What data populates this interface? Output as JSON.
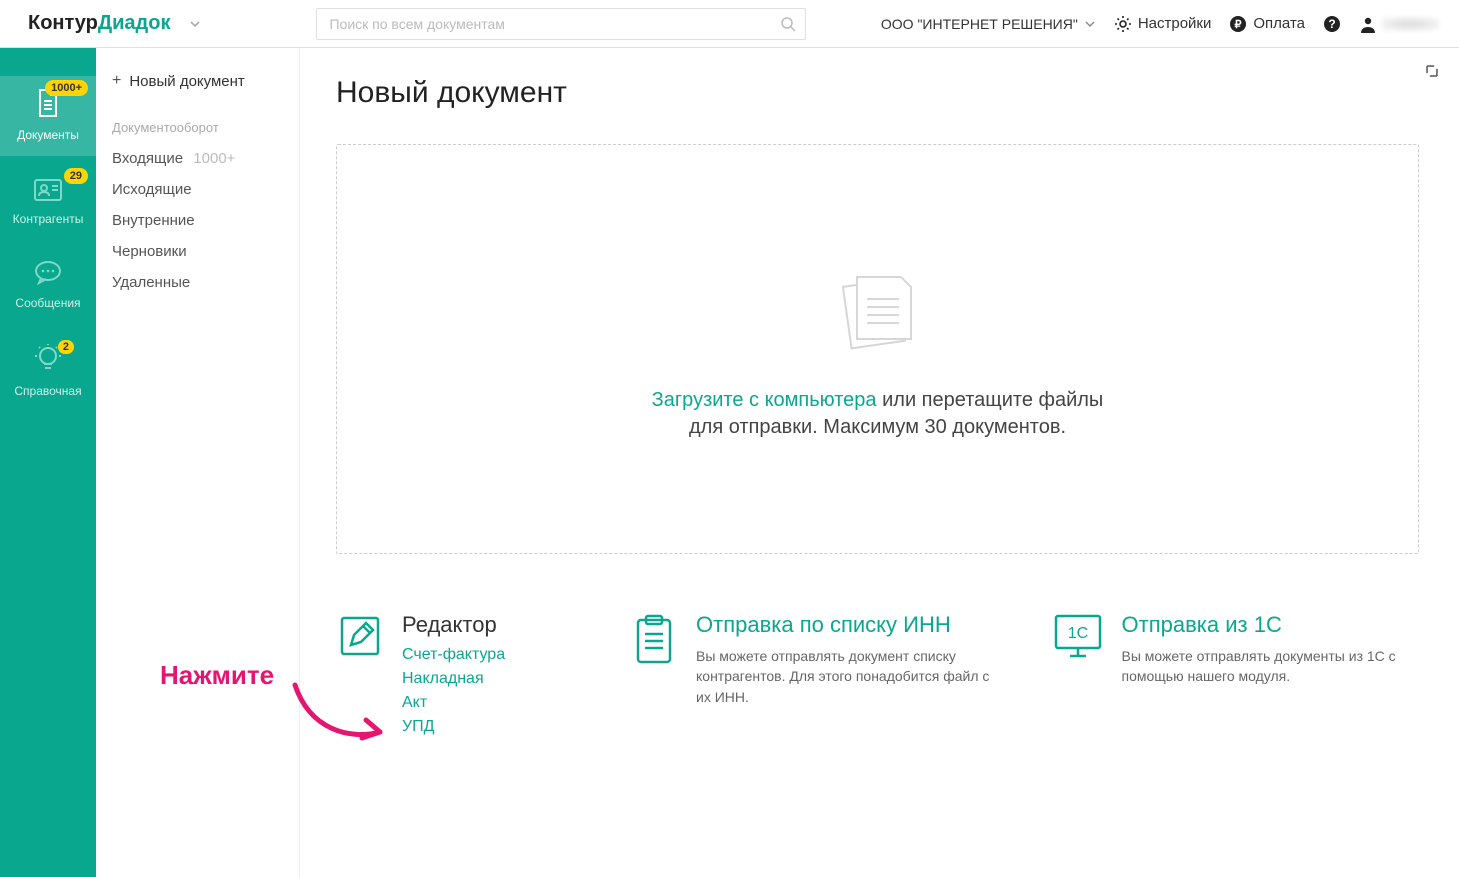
{
  "header": {
    "logo_part1": "Контур",
    "logo_part2": "Диадок",
    "search_placeholder": "Поиск по всем документам",
    "org_name": "ООО \"ИНТЕРНЕТ РЕШЕНИЯ\"",
    "settings": "Настройки",
    "payment": "Оплата"
  },
  "rail": {
    "documents": {
      "label": "Документы",
      "badge": "1000+"
    },
    "contragents": {
      "label": "Контрагенты",
      "badge": "29"
    },
    "messages": {
      "label": "Сообщения"
    },
    "help": {
      "label": "Справочная",
      "badge": "2"
    }
  },
  "sub": {
    "new_document": "Новый документ",
    "section": "Документооборот",
    "inbox": {
      "label": "Входящие",
      "count": "1000+"
    },
    "outbox": "Исходящие",
    "internal": "Внутренние",
    "drafts": "Черновики",
    "deleted": "Удаленные"
  },
  "main": {
    "title": "Новый документ",
    "upload_link": "Загрузите с компьютера",
    "upload_rest": " или перетащите файлы",
    "upload_line2": "для отправки. Максимум 30 документов."
  },
  "cols": {
    "editor": {
      "title": "Редактор",
      "links": [
        "Счет-фактура",
        "Накладная",
        "Акт",
        "УПД"
      ]
    },
    "inn": {
      "title": "Отправка по списку ИНН",
      "desc": "Вы можете отправлять документ списку контрагентов. Для этого понадобится файл с их ИНН."
    },
    "onec": {
      "title": "Отправка из 1С",
      "desc": "Вы можете отправлять документы из 1С с помощью нашего модуля."
    }
  },
  "annotation": {
    "label": "Нажмите"
  }
}
